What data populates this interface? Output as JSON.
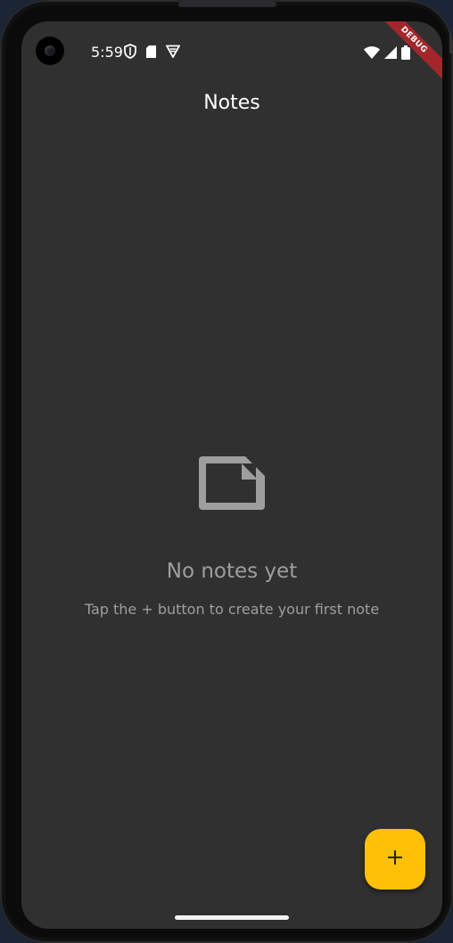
{
  "status_bar": {
    "time": "5:59",
    "left_icons": [
      "shield-icon",
      "sd-card-icon",
      "vpn-key-icon"
    ],
    "right_icons": [
      "wifi-icon",
      "cell-signal-icon",
      "battery-icon"
    ]
  },
  "debug_banner": {
    "label": "DEBUG",
    "color": "#a3262a"
  },
  "app_bar": {
    "title": "Notes"
  },
  "empty_state": {
    "icon": "note-icon",
    "title": "No notes yet",
    "subtitle": "Tap the + button to create your first note"
  },
  "fab": {
    "icon": "plus-icon",
    "color": "#ffc107"
  },
  "theme": {
    "background": "#303030",
    "muted_text": "#9e9e9e",
    "accent": "#ffc107"
  }
}
